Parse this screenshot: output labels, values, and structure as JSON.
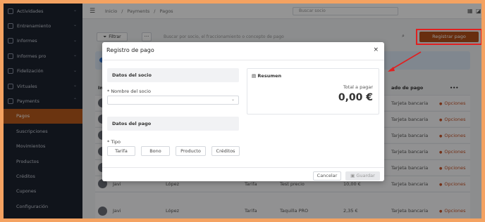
{
  "sidebar": {
    "items": [
      {
        "label": "Actividades"
      },
      {
        "label": "Entrenamiento"
      },
      {
        "label": "Informes"
      },
      {
        "label": "Informes pro"
      },
      {
        "label": "Fidelización"
      },
      {
        "label": "Virtuales"
      },
      {
        "label": "Payments"
      }
    ],
    "sub_items": [
      {
        "label": "Pagos"
      },
      {
        "label": "Suscripciones"
      },
      {
        "label": "Movimientos"
      },
      {
        "label": "Productos"
      },
      {
        "label": "Créditos"
      },
      {
        "label": "Cupones"
      },
      {
        "label": "Configuración"
      }
    ]
  },
  "header": {
    "crumb_1": "Inicio",
    "crumb_sep": "/",
    "crumb_2": "Payments",
    "crumb_3": "Pagos",
    "search_placeholder": "Buscar socio"
  },
  "toolbar": {
    "filter_label": "Filtrar",
    "more_label": "···",
    "search_placeholder": "Buscar por socio, el fraccionamiento o concepto de pago",
    "register_label": "Registrar pago"
  },
  "table": {
    "headers": {
      "first": "Im",
      "status": "ado de pago",
      "actions": "•••"
    },
    "rows": [
      {
        "status": "Tarjeta bancaria",
        "action": "Opciones"
      },
      {
        "status": "Tarjeta bancaria",
        "action": "Opciones"
      },
      {
        "status": "Tarjeta bancaria",
        "action": "Opciones"
      },
      {
        "status": "Tarjeta bancaria",
        "action": "Opciones"
      },
      {
        "status": "Tarjeta bancaria",
        "action": "Opciones"
      },
      {
        "name": "Javi",
        "surname": "López",
        "type": "Tarifa",
        "concept": "Test precio",
        "amount": "10,00 €",
        "status": "Tarjeta bancaria",
        "action": "Opciones"
      },
      {
        "name": "Javi",
        "surname": "López",
        "type": "Tarifa",
        "concept": "Taquilla PRO",
        "amount": "2,35 €",
        "status": "Tarjeta bancaria",
        "action": "Opciones"
      }
    ]
  },
  "modal": {
    "title": "Registro de pago",
    "close": "×",
    "member_section": "Datos del socio",
    "member_name_label": "* Nombre del socio",
    "payment_section": "Datos del pago",
    "type_label": "* Tipo",
    "type_options": [
      "Tarifa",
      "Bono",
      "Producto",
      "Créditos"
    ],
    "summary_title": "Resumen",
    "total_label": "Total a pagar",
    "total_value": "0,00 €",
    "cancel_label": "Cancelar",
    "save_label": "Guardar"
  },
  "colors": {
    "accent": "#b3501a",
    "highlight": "#e02020",
    "frame": "#f4a261",
    "sidebar": "#1d2330"
  }
}
